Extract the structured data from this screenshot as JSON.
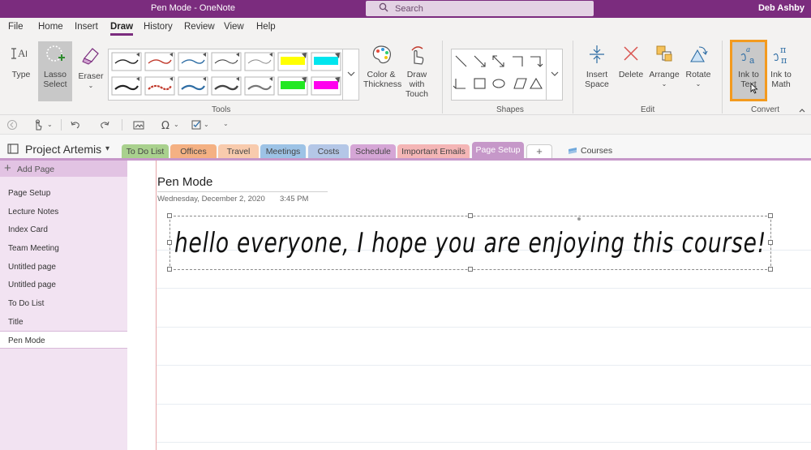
{
  "titlebar": {
    "app_title": "Pen Mode  -  OneNote",
    "search_placeholder": "Search",
    "user": "Deb Ashby"
  },
  "menu": {
    "tabs": [
      "File",
      "Home",
      "Insert",
      "Draw",
      "History",
      "Review",
      "View",
      "Help"
    ],
    "active": "Draw"
  },
  "ribbon": {
    "type_label": "Type",
    "lasso_label_1": "Lasso",
    "lasso_label_2": "Select",
    "eraser_label": "Eraser",
    "color_label_1": "Color &",
    "color_label_2": "Thickness",
    "draw_touch_1": "Draw with",
    "draw_touch_2": "Touch",
    "tools_group": "Tools",
    "shapes_group": "Shapes",
    "insert_space_1": "Insert",
    "insert_space_2": "Space",
    "delete_label": "Delete",
    "arrange_label": "Arrange",
    "rotate_label": "Rotate",
    "edit_group": "Edit",
    "ink_text_1": "Ink to",
    "ink_text_2": "Text",
    "ink_math_1": "Ink to",
    "ink_math_2": "Math",
    "convert_group": "Convert",
    "accent": "#7b2c7e",
    "highlight": "#f39a1e"
  },
  "notebook": {
    "name": "Project Artemis",
    "sections": [
      {
        "label": "To Do List",
        "color": "#a9d18e"
      },
      {
        "label": "Offices",
        "color": "#f4b183"
      },
      {
        "label": "Travel",
        "color": "#f8cbad"
      },
      {
        "label": "Meetings",
        "color": "#9dc3e6"
      },
      {
        "label": "Costs",
        "color": "#b4c7e7"
      },
      {
        "label": "Schedule",
        "color": "#d5a6d6"
      },
      {
        "label": "Important Emails",
        "color": "#f4b6b6"
      },
      {
        "label": "Page Setup",
        "color": "#c698c9"
      }
    ],
    "active_section": "Page Setup",
    "add_tab": "+",
    "other_notebook": "Courses"
  },
  "pages": {
    "add_label": "Add Page",
    "items": [
      "Page Setup",
      "Lecture Notes",
      "Index Card",
      "Team Meeting",
      "Untitled page",
      "Untitled page",
      "To Do List",
      "Title",
      "Pen Mode"
    ],
    "active": "Pen Mode"
  },
  "page": {
    "title": "Pen Mode",
    "date": "Wednesday, December 2, 2020",
    "time": "3:45 PM",
    "ink_text": "hello everyone, I hope you are enjoying this course!"
  }
}
